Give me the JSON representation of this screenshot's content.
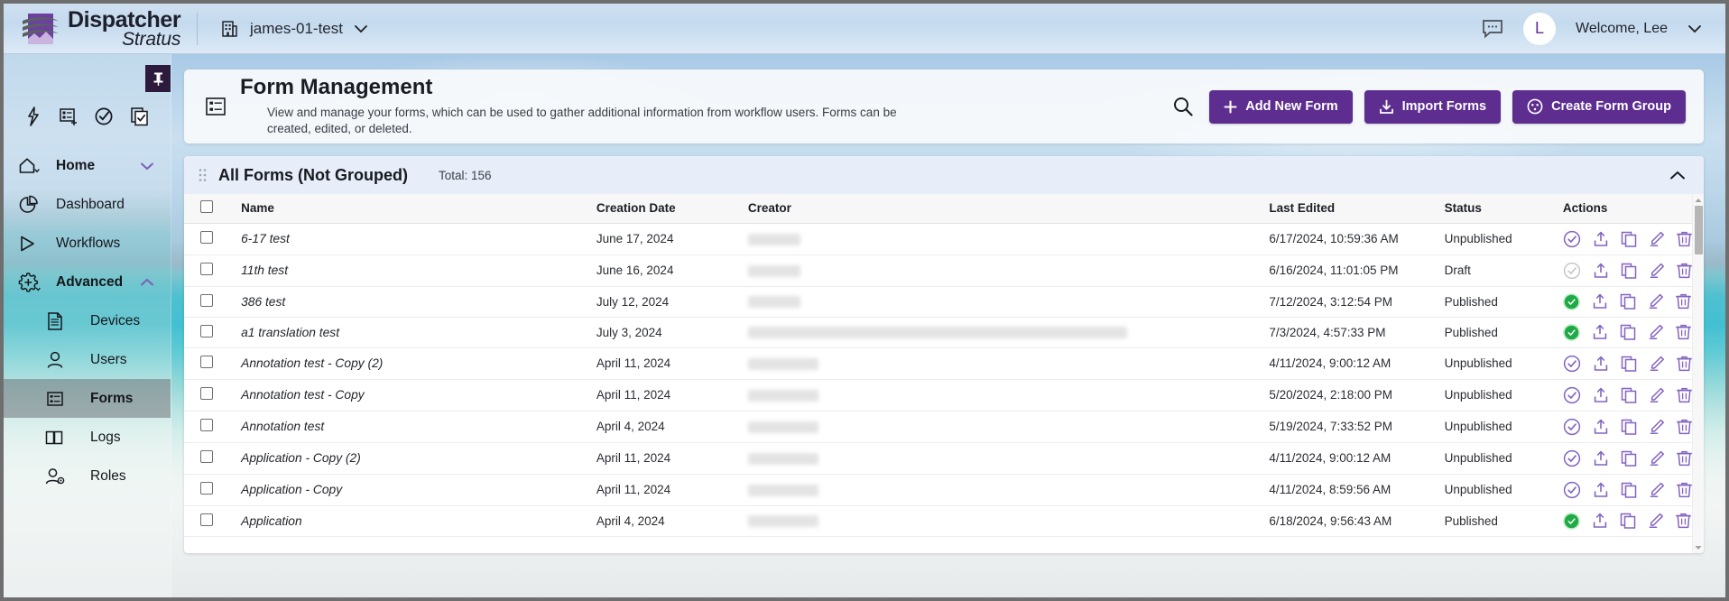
{
  "topbar": {
    "brand_line1": "Dispatcher",
    "brand_line2": "Stratus",
    "tenant": "james-01-test",
    "chat_icon": "chat-bubble-icon",
    "avatar_initial": "L",
    "welcome": "Welcome, Lee"
  },
  "sidebar": {
    "pin_icon": "pushpin-icon",
    "quick_icons": [
      "lightning-bolt-icon",
      "add-form-icon",
      "check-circle-icon",
      "copy-check-icon"
    ],
    "items": [
      {
        "label": "Home",
        "icon": "home-icon",
        "type": "group",
        "expanded": false,
        "active": false
      },
      {
        "label": "Dashboard",
        "icon": "pie-chart-icon",
        "type": "item",
        "active": false
      },
      {
        "label": "Workflows",
        "icon": "play-icon",
        "type": "item",
        "active": false
      },
      {
        "label": "Advanced",
        "icon": "gear-plus-icon",
        "type": "group",
        "expanded": true,
        "active": false
      },
      {
        "label": "Devices",
        "icon": "device-icon",
        "type": "sub",
        "active": false
      },
      {
        "label": "Users",
        "icon": "user-icon",
        "type": "sub",
        "active": false
      },
      {
        "label": "Forms",
        "icon": "forms-icon",
        "type": "sub",
        "active": true
      },
      {
        "label": "Logs",
        "icon": "book-icon",
        "type": "sub",
        "active": false
      },
      {
        "label": "Roles",
        "icon": "user-gear-icon",
        "type": "sub",
        "active": false
      }
    ]
  },
  "page": {
    "icon": "forms-icon",
    "title": "Form Management",
    "description": "View and manage your forms, which can be used to gather additional information from workflow users. Forms can be created, edited, or deleted.",
    "search_icon": "search-icon",
    "buttons": [
      {
        "label": "Add New Form",
        "icon": "plus-icon"
      },
      {
        "label": "Import Forms",
        "icon": "download-icon"
      },
      {
        "label": "Create Form Group",
        "icon": "group-circle-icon"
      }
    ]
  },
  "group_bar": {
    "drag_handle_icon": "drag-dots-icon",
    "title": "All Forms (Not Grouped)",
    "total": "Total: 156",
    "collapse_icon": "chevron-up-icon"
  },
  "table": {
    "columns": [
      "Name",
      "Creation Date",
      "Creator",
      "Last Edited",
      "Status",
      "Actions"
    ],
    "row_action_icons": [
      "publish-check-icon",
      "export-icon",
      "duplicate-icon",
      "edit-pencil-icon",
      "delete-trash-icon"
    ],
    "rows": [
      {
        "name": "6-17 test",
        "creation_date": "June 17, 2024",
        "creator": "",
        "last_edited": "6/17/2024, 10:59:36 AM",
        "status": "Unpublished",
        "creator_width": 58
      },
      {
        "name": "11th test",
        "creation_date": "June 16, 2024",
        "creator": "",
        "last_edited": "6/16/2024, 11:01:05 PM",
        "status": "Draft",
        "creator_width": 58
      },
      {
        "name": "386 test",
        "creation_date": "July 12, 2024",
        "creator": "",
        "last_edited": "7/12/2024, 3:12:54 PM",
        "status": "Published",
        "creator_width": 58
      },
      {
        "name": "a1 translation test",
        "creation_date": "July 3, 2024",
        "creator": "",
        "last_edited": "7/3/2024, 4:57:33 PM",
        "status": "Published",
        "creator_width": 420
      },
      {
        "name": "Annotation test - Copy (2)",
        "creation_date": "April 11, 2024",
        "creator": "",
        "last_edited": "4/11/2024, 9:00:12 AM",
        "status": "Unpublished",
        "creator_width": 78
      },
      {
        "name": "Annotation test - Copy",
        "creation_date": "April 11, 2024",
        "creator": "",
        "last_edited": "5/20/2024, 2:18:00 PM",
        "status": "Unpublished",
        "creator_width": 78
      },
      {
        "name": "Annotation test",
        "creation_date": "April 4, 2024",
        "creator": "",
        "last_edited": "5/19/2024, 7:33:52 PM",
        "status": "Unpublished",
        "creator_width": 78
      },
      {
        "name": "Application - Copy (2)",
        "creation_date": "April 11, 2024",
        "creator": "",
        "last_edited": "4/11/2024, 9:00:12 AM",
        "status": "Unpublished",
        "creator_width": 78
      },
      {
        "name": "Application - Copy",
        "creation_date": "April 11, 2024",
        "creator": "",
        "last_edited": "4/11/2024, 8:59:56 AM",
        "status": "Unpublished",
        "creator_width": 78
      },
      {
        "name": "Application",
        "creation_date": "April 4, 2024",
        "creator": "",
        "last_edited": "6/18/2024, 9:56:43 AM",
        "status": "Published",
        "creator_width": 78
      }
    ]
  },
  "colors": {
    "accent_purple": "#5d2e90",
    "icon_purple": "#8464c0",
    "published_green": "#1faa47",
    "published_badge_bg": "#c9f0cd",
    "group_bar_bg": "#e7eefa"
  }
}
